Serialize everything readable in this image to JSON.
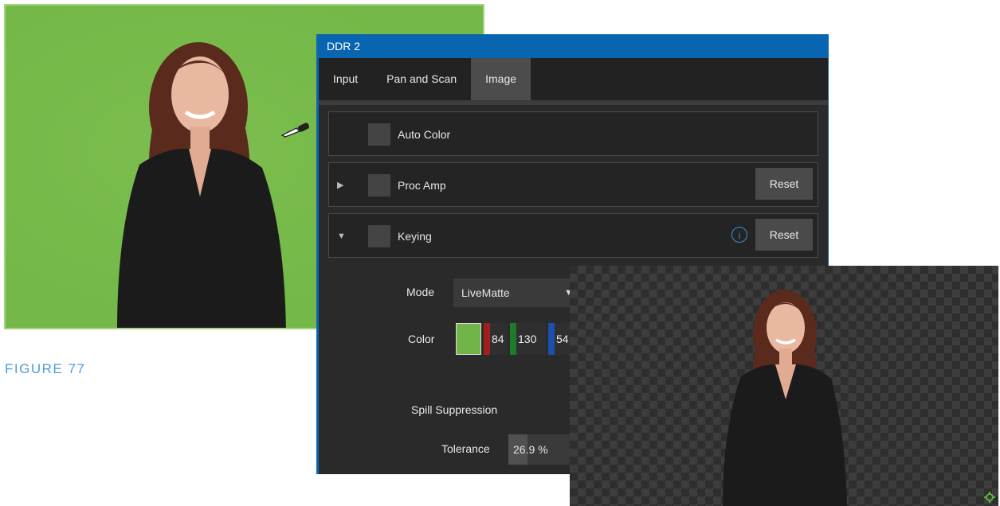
{
  "caption": "FIGURE 77",
  "panel": {
    "title": "DDR 2",
    "tabs": [
      {
        "label": "Input",
        "active": false
      },
      {
        "label": "Pan and Scan",
        "active": false
      },
      {
        "label": "Image",
        "active": true
      }
    ],
    "sections": {
      "auto_color": {
        "label": "Auto Color"
      },
      "proc_amp": {
        "label": "Proc Amp",
        "reset_label": "Reset",
        "expanded": false
      },
      "keying": {
        "label": "Keying",
        "reset_label": "Reset",
        "info_label": "i",
        "expanded": true
      }
    },
    "keying": {
      "mode_label": "Mode",
      "mode_value": "LiveMatte",
      "color_label": "Color",
      "color_swatch": "#70b44a",
      "rgb": {
        "r": "84",
        "g": "130",
        "b": "54"
      },
      "spill_label": "Spill Suppression",
      "tolerance_label": "Tolerance",
      "tolerance_value": "26.9 %",
      "tolerance_fraction": 0.269
    }
  },
  "colors": {
    "accent_blue": "#0a65b0",
    "green_screen": "#73b848",
    "caption_blue": "#4d9bd8"
  },
  "icons": {
    "eyedropper": "eyedropper-icon",
    "settings": "gear-icon"
  }
}
